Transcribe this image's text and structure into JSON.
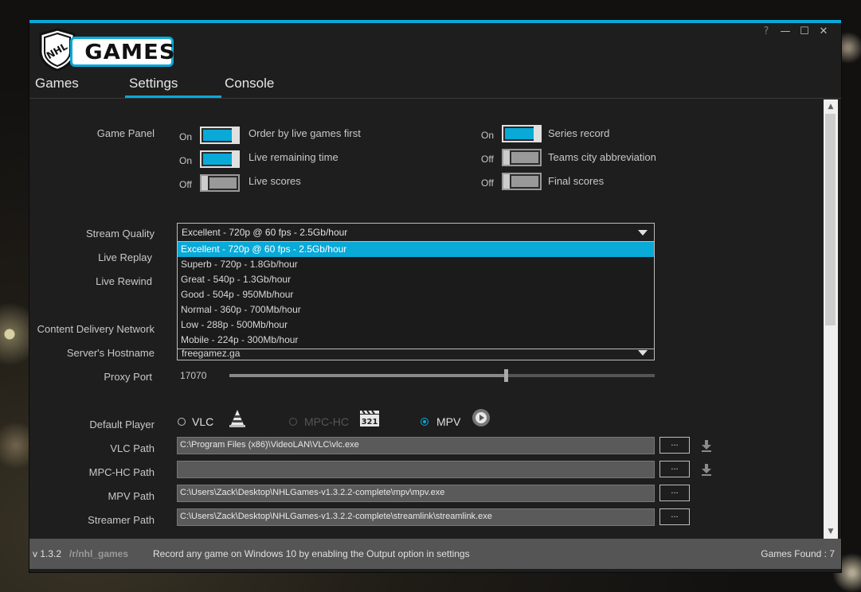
{
  "app": {
    "logo_text": "GAMES",
    "shield_text": "NHL",
    "window_controls": {
      "help": "?",
      "minimize": "—",
      "maximize": "☐",
      "close": "✕"
    }
  },
  "tabs": [
    {
      "label": "Games"
    },
    {
      "label": "Settings",
      "active": true
    },
    {
      "label": "Console"
    }
  ],
  "game_panel": {
    "label": "Game Panel",
    "toggles": [
      {
        "state": "On",
        "label": "Order by live games first",
        "on": true
      },
      {
        "state": "On",
        "label": "Live remaining time",
        "on": true
      },
      {
        "state": "Off",
        "label": "Live scores",
        "on": false
      },
      {
        "state": "On",
        "label": "Series record",
        "on": true
      },
      {
        "state": "Off",
        "label": "Teams city abbreviation",
        "on": false
      },
      {
        "state": "Off",
        "label": "Final scores",
        "on": false
      }
    ]
  },
  "stream_quality": {
    "label": "Stream Quality",
    "selected": "Excellent - 720p @ 60 fps - 2.5Gb/hour",
    "options": [
      "Excellent - 720p @ 60 fps - 2.5Gb/hour",
      "Superb - 720p - 1.8Gb/hour",
      "Great - 540p - 1.3Gb/hour",
      "Good - 504p - 950Mb/hour",
      "Normal - 360p - 700Mb/hour",
      "Low - 288p - 500Mb/hour",
      "Mobile - 224p - 300Mb/hour"
    ]
  },
  "live_replay": {
    "label": "Live Replay"
  },
  "live_rewind": {
    "label": "Live Rewind"
  },
  "cdn": {
    "label": "Content Delivery Network"
  },
  "hostname": {
    "label": "Server's Hostname",
    "value": "freegamez.ga"
  },
  "proxy": {
    "label": "Proxy Port",
    "value": "17070",
    "slider_fraction": 0.65
  },
  "default_player": {
    "label": "Default Player",
    "options": [
      {
        "label": "VLC",
        "checked": false,
        "disabled": false,
        "icon": "vlc-cone-icon"
      },
      {
        "label": "MPC-HC",
        "checked": false,
        "disabled": true,
        "icon": "mpc-clapper-icon"
      },
      {
        "label": "MPV",
        "checked": true,
        "disabled": false,
        "icon": "mpv-play-icon"
      }
    ]
  },
  "paths": [
    {
      "label": "VLC Path",
      "value": "C:\\Program Files (x86)\\VideoLAN\\VLC\\vlc.exe",
      "button": "...",
      "download": true
    },
    {
      "label": "MPC-HC Path",
      "value": "",
      "button": "...",
      "download": true
    },
    {
      "label": "MPV Path",
      "value": "C:\\Users\\Zack\\Desktop\\NHLGames-v1.3.2.2-complete\\mpv\\mpv.exe",
      "button": "...",
      "download": false
    },
    {
      "label": "Streamer Path",
      "value": "C:\\Users\\Zack\\Desktop\\NHLGames-v1.3.2.2-complete\\streamlink\\streamlink.exe",
      "button": "...",
      "download": false
    }
  ],
  "status": {
    "version": "v 1.3.2",
    "subreddit": "/r/nhl_games",
    "tip": "Record any game on Windows 10 by enabling the Output option in settings",
    "games_found": "Games Found : 7"
  },
  "colors": {
    "accent": "#09a9d8",
    "background": "#1e1e1e",
    "statusbar": "#555555"
  }
}
